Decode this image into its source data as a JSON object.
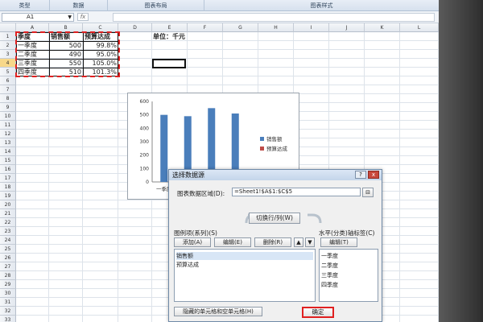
{
  "ribbon": {
    "groups": [
      "类型",
      "数据",
      "图表布局",
      "图表样式"
    ]
  },
  "formula_bar": {
    "name_box": "A1",
    "fx": "fx"
  },
  "columns": [
    "A",
    "B",
    "C",
    "D",
    "E",
    "F",
    "G",
    "H",
    "I",
    "J",
    "K",
    "L"
  ],
  "rows": [
    "1",
    "2",
    "3",
    "4",
    "5",
    "6",
    "7",
    "8",
    "9",
    "10",
    "11",
    "12",
    "13",
    "14",
    "15",
    "16",
    "17",
    "18",
    "19",
    "20",
    "21",
    "22",
    "23",
    "24",
    "25",
    "26",
    "27",
    "28",
    "29",
    "30",
    "31",
    "32",
    "33"
  ],
  "sheet": {
    "headers": [
      "季度",
      "销售额",
      "预算达成"
    ],
    "data": [
      [
        "一季度",
        "500",
        "99.8%"
      ],
      [
        "二季度",
        "490",
        "95.0%"
      ],
      [
        "三季度",
        "550",
        "105.0%"
      ],
      [
        "四季度",
        "510",
        "101.3%"
      ]
    ],
    "unit_label": "单位：千元"
  },
  "chart_data": {
    "type": "bar",
    "categories": [
      "一季度",
      "二季度",
      "三季度",
      "四季度"
    ],
    "series": [
      {
        "name": "销售额",
        "values": [
          500,
          490,
          550,
          510
        ],
        "color": "#4a7ebb"
      },
      {
        "name": "预算达成",
        "values": [
          0.998,
          0.95,
          1.05,
          1.013
        ],
        "color": "#be4b48"
      }
    ],
    "yticks": [
      "0",
      "100",
      "200",
      "300",
      "400",
      "500",
      "600"
    ],
    "ylim": [
      0,
      600
    ],
    "legend": "right",
    "grid": false
  },
  "dialog": {
    "title": "选择数据源",
    "help": "?",
    "close": "x",
    "range_label": "图表数据区域(D):",
    "range_value": "=Sheet1!$A$1:$C$5",
    "switch_button": "切换行/列(W)",
    "legend_label": "图例项(系列)(S)",
    "add_button": "添加(A)",
    "edit_button": "编辑(E)",
    "delete_button": "删除(R)",
    "series": [
      "销售额",
      "预算达成"
    ],
    "axis_label": "水平(分类)轴标签(C)",
    "axis_edit_button": "编辑(T)",
    "axis_items": [
      "一季度",
      "二季度",
      "三季度",
      "四季度"
    ],
    "hidden_cells_button": "隐藏的单元格和空单元格(H)",
    "ok_button": "确定"
  }
}
